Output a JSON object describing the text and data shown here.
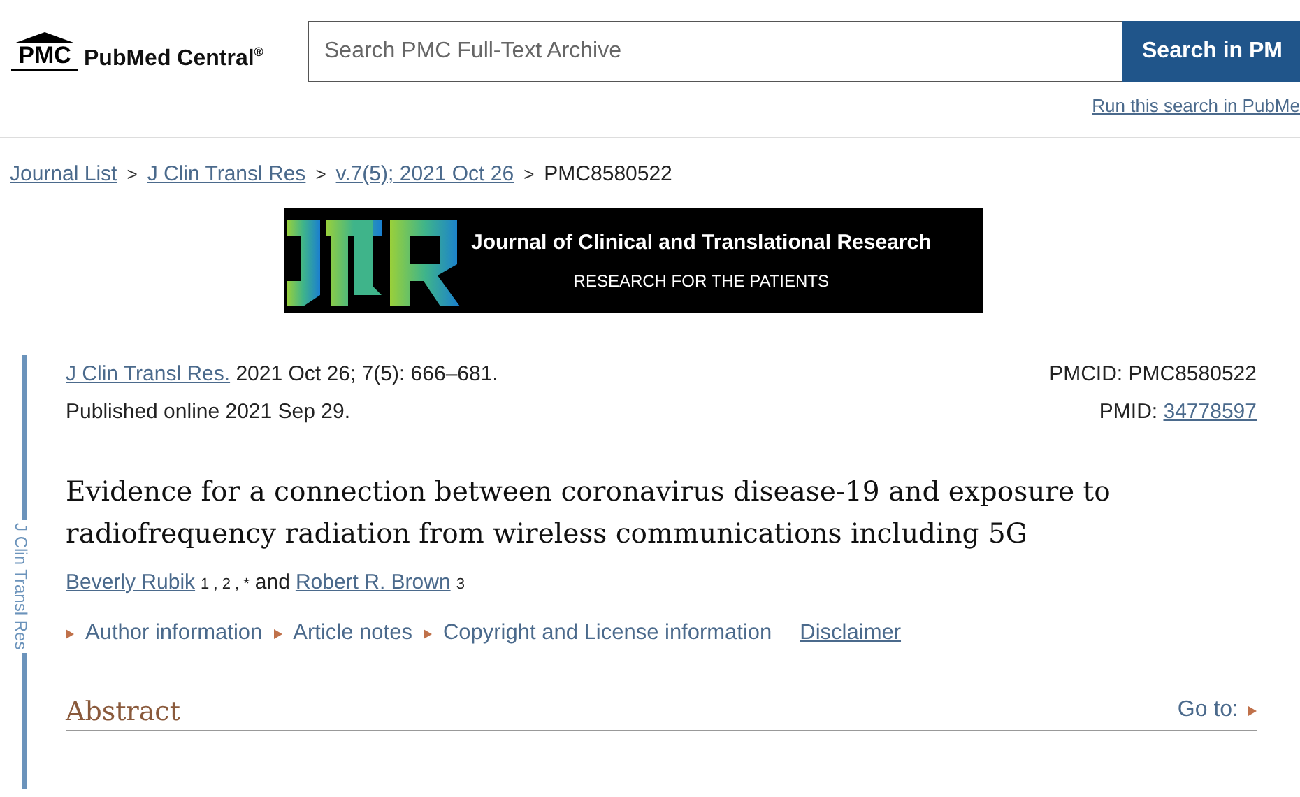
{
  "header": {
    "logo_mark": "PMC",
    "logo_text": "PubMed Central",
    "logo_reg": "®",
    "search": {
      "placeholder": "Search PMC Full-Text Archive"
    },
    "search_button": "Search in PM",
    "alt_link": "Run this search in PubMe"
  },
  "breadcrumbs": [
    {
      "label": "Journal List",
      "link": true
    },
    {
      "label": "J Clin Transl Res",
      "link": true
    },
    {
      "label": "v.7(5); 2021 Oct 26",
      "link": true
    },
    {
      "label": "PMC8580522",
      "link": false
    }
  ],
  "breadcrumb_separator": ">",
  "banner": {
    "title": "Journal of Clinical and Translational Research",
    "subtitle": "RESEARCH FOR THE PATIENTS"
  },
  "side_label": "J Clin Transl Res",
  "citation": {
    "journal": "J Clin Transl Res.",
    "details": "2021 Oct 26; 7(5): 666–681.",
    "published": "Published online 2021 Sep 29.",
    "pmcid": "PMCID: PMC8580522",
    "pmid_label": "PMID:",
    "pmid": "34778597"
  },
  "title": "Evidence for a connection between coronavirus disease-19 and exposure to radiofrequency radiation from wireless communications including 5G",
  "authors": [
    {
      "name": "Beverly Rubik",
      "marks": "1 , 2 , *"
    },
    {
      "name": "Robert R. Brown",
      "marks": "3"
    }
  ],
  "author_joiner": "and",
  "info_links": [
    {
      "label": "Author information",
      "kind": "toggle"
    },
    {
      "label": "Article notes",
      "kind": "toggle"
    },
    {
      "label": "Copyright and License information",
      "kind": "toggle"
    },
    {
      "label": "Disclaimer",
      "kind": "link"
    }
  ],
  "section": {
    "heading": "Abstract",
    "goto": "Go to:"
  }
}
